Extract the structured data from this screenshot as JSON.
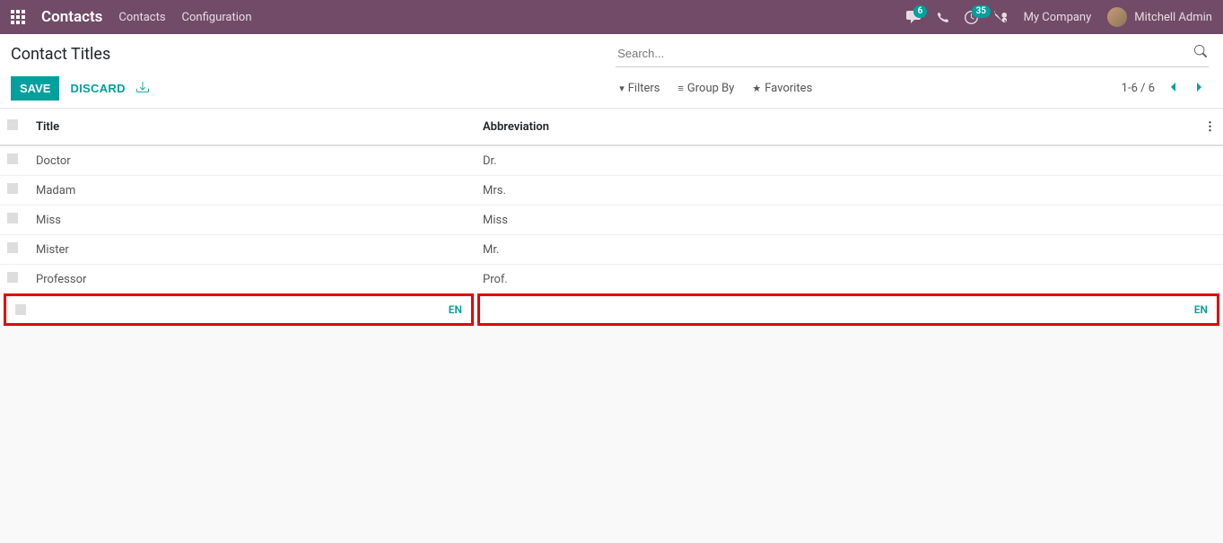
{
  "header": {
    "app_name": "Contacts",
    "nav": [
      "Contacts",
      "Configuration"
    ],
    "chat_badge": "6",
    "activity_badge": "35",
    "company": "My Company",
    "user": "Mitchell Admin"
  },
  "control": {
    "title": "Contact Titles",
    "save": "SAVE",
    "discard": "DISCARD",
    "search_placeholder": "Search...",
    "filters": "Filters",
    "group_by": "Group By",
    "favorites": "Favorites",
    "pager": "1-6 / 6"
  },
  "table": {
    "col_title": "Title",
    "col_abbr": "Abbreviation",
    "rows": [
      {
        "title": "Doctor",
        "abbr": "Dr."
      },
      {
        "title": "Madam",
        "abbr": "Mrs."
      },
      {
        "title": "Miss",
        "abbr": "Miss"
      },
      {
        "title": "Mister",
        "abbr": "Mr."
      },
      {
        "title": "Professor",
        "abbr": "Prof."
      }
    ],
    "edit": {
      "title": "",
      "abbr": "",
      "lang": "EN"
    }
  }
}
